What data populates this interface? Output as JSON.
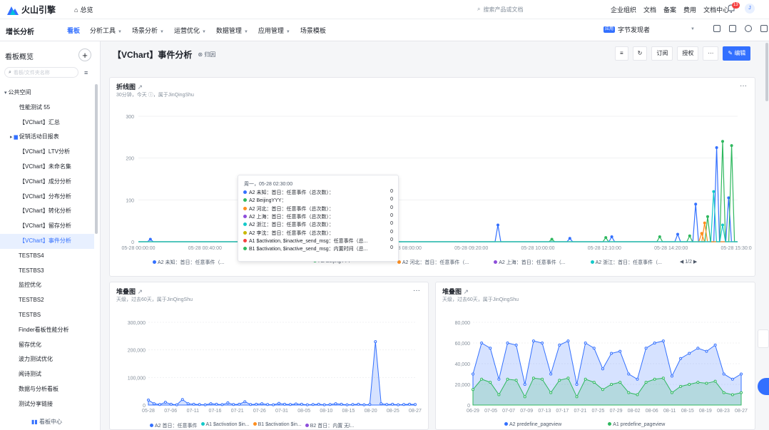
{
  "topbar": {
    "brand": "火山引擎",
    "home": "总览",
    "search_placeholder": "搜索产品或文档",
    "links": [
      "企业组织",
      "文档",
      "备案",
      "费用",
      "文档中心"
    ],
    "notif_count": "13",
    "avatar": "J"
  },
  "nav": {
    "section": "增长分析",
    "menu": [
      {
        "label": "看板",
        "active": true
      },
      {
        "label": "分析工具",
        "caret": true
      },
      {
        "label": "场景分析",
        "caret": true
      },
      {
        "label": "运营优化",
        "caret": true
      },
      {
        "label": "数据管理",
        "caret": true
      },
      {
        "label": "应用管理",
        "caret": true
      },
      {
        "label": "场景模板"
      }
    ],
    "workspace_tag": "应用",
    "workspace": "字节发现者"
  },
  "sidebar": {
    "title": "看板概览",
    "search_placeholder": "看板/文件夹名称",
    "items": [
      {
        "label": "公共空间",
        "type": "group",
        "arrow": "▾"
      },
      {
        "label": "性能测试 55",
        "type": "l1"
      },
      {
        "label": "【VChart】汇总",
        "type": "l1"
      },
      {
        "label": "促销活动日报表",
        "type": "folder",
        "arrow": "▸"
      },
      {
        "label": "【VChart】LTV分析",
        "type": "l1"
      },
      {
        "label": "【VChart】未命名集",
        "type": "l1"
      },
      {
        "label": "【VChart】成分分析",
        "type": "l1"
      },
      {
        "label": "【VChart】分布分析",
        "type": "l1"
      },
      {
        "label": "【VChart】转化分析",
        "type": "l1"
      },
      {
        "label": "【VChart】留存分析",
        "type": "l1"
      },
      {
        "label": "【VChart】事件分析",
        "type": "l1",
        "selected": true
      },
      {
        "label": "TESTBS4",
        "type": "l0"
      },
      {
        "label": "TESTBS3",
        "type": "l0"
      },
      {
        "label": "监控优化",
        "type": "l0"
      },
      {
        "label": "TESTBS2",
        "type": "l0"
      },
      {
        "label": "TESTBS",
        "type": "l0"
      },
      {
        "label": "Finder看板性能分析",
        "type": "l0"
      },
      {
        "label": "留存优化",
        "type": "l0"
      },
      {
        "label": "波力测试优化",
        "type": "l0"
      },
      {
        "label": "闻诗测试",
        "type": "l0"
      },
      {
        "label": "数据与分析看板",
        "type": "l0"
      },
      {
        "label": "测试分享链接",
        "type": "l0"
      }
    ],
    "footer": "看板中心"
  },
  "main": {
    "title": "【VChart】事件分析",
    "scope": "归因",
    "actions": [
      "订阅",
      "授权",
      "···",
      "编辑"
    ]
  },
  "line_card": {
    "title": "折线图",
    "subtitle": "30分钟，今天 ⓘ，属于JinQingShu",
    "more": "···",
    "x_ticks": [
      "05-28 00:00:00",
      "05-28 00:40:00",
      "05-28 04:00:00",
      "05-28 05:50:00",
      "05-28 08:00:00",
      "05-28 09:20:00",
      "05-28 10:00:00",
      "05-28 12:10:00",
      "05-28 14:20:00",
      "05-28 15:30:00"
    ],
    "y_ticks": [
      "0",
      "100",
      "200",
      "300"
    ],
    "legend": [
      "A2 未知：首日：任意事件（...",
      "A2 BeijingYYY",
      "A2 河北：首日：任意事件（...",
      "A2 上海：首日：任意事件（...",
      "A2 浙江：首日：任意事件（..."
    ],
    "pager": "1/2"
  },
  "chart_data": [
    {
      "type": "line",
      "title": "折线图",
      "ylim": [
        0,
        300
      ],
      "series": [
        {
          "name": "A2 未知：首日：任意事件",
          "color": "#3370ff",
          "values": [
            0,
            0,
            0,
            0,
            0,
            0,
            0,
            0,
            0,
            0,
            0,
            0,
            0,
            0,
            0,
            0,
            0,
            0,
            0,
            0,
            0,
            0,
            0,
            0,
            0,
            0,
            0,
            0,
            0,
            0,
            0,
            0,
            0,
            0,
            0,
            0,
            0,
            0,
            0,
            0,
            0,
            0,
            0,
            0,
            0,
            0,
            0,
            0,
            0,
            0,
            0,
            0,
            0,
            0,
            0,
            0,
            0,
            0,
            0,
            0,
            0,
            0,
            0,
            0,
            0,
            0,
            0,
            0,
            0,
            0,
            0,
            0,
            0,
            0,
            0,
            0,
            0,
            0,
            0,
            0,
            0,
            0,
            0,
            0,
            0,
            0,
            0,
            0,
            0,
            0,
            0,
            0,
            0,
            0,
            0,
            0,
            0,
            0,
            0,
            0,
            0,
            0,
            0,
            0,
            0,
            0,
            0,
            0,
            0,
            0,
            0,
            0,
            0,
            0,
            0,
            0,
            0,
            0,
            0,
            0,
            0,
            0,
            0,
            0,
            0,
            0,
            0,
            0,
            0,
            0,
            0,
            0,
            0,
            0,
            0,
            0,
            0,
            0,
            0,
            0,
            0,
            0,
            0,
            0,
            0,
            0,
            0,
            0,
            0,
            0,
            0,
            0,
            0,
            0,
            0,
            0,
            0,
            0,
            0,
            0,
            0,
            0,
            0,
            0,
            0,
            0,
            0,
            0,
            0,
            0,
            0,
            0,
            0,
            0,
            0,
            0,
            0,
            0,
            0,
            0,
            0,
            0,
            0,
            0,
            0,
            0,
            0,
            0,
            0,
            0,
            0,
            0,
            0,
            0,
            0,
            0,
            0,
            0,
            0,
            0,
            0,
            0,
            0,
            0,
            0,
            0,
            0,
            0,
            0,
            0,
            0,
            0,
            0,
            0,
            0,
            0,
            0,
            0,
            0,
            0,
            0,
            0,
            0,
            0,
            0,
            0,
            0,
            0,
            0,
            0,
            0,
            0,
            0,
            0,
            0,
            0,
            0,
            0,
            0,
            0,
            0,
            0,
            0,
            0,
            0,
            0,
            0,
            0,
            0,
            0,
            0,
            0,
            0,
            0,
            0,
            0,
            0,
            0,
            0,
            0,
            0,
            0,
            0,
            0,
            0,
            0,
            0,
            0,
            0,
            0,
            0,
            0,
            0,
            0,
            0,
            0,
            0,
            0,
            0,
            0,
            0,
            0,
            0,
            0,
            0,
            0,
            0,
            0,
            0,
            0,
            0,
            0,
            0,
            0,
            0,
            0,
            0,
            0,
            0,
            0,
            0,
            0,
            0,
            0,
            0,
            0,
            0,
            0,
            0,
            0,
            0,
            0,
            0,
            0,
            0,
            0,
            0,
            0,
            0,
            0,
            0,
            0,
            0,
            0,
            0,
            0,
            0,
            0,
            0,
            0,
            0,
            0,
            0,
            0,
            0,
            0,
            0,
            0,
            0,
            0,
            0,
            0,
            0,
            0,
            0
          ]
        },
        {
          "name": "A2 BeijingYYY",
          "color": "#2fb85f",
          "values": []
        },
        {
          "name": "A2 河北：首日：任意事件",
          "color": "#ff8f1f",
          "values": []
        },
        {
          "name": "A2 上海：首日：任意事件",
          "color": "#8d4eda",
          "values": []
        },
        {
          "name": "A2 浙江：首日：任意事件",
          "color": "#14c9c9",
          "values": []
        }
      ]
    },
    {
      "type": "area",
      "title": "堆叠图",
      "ylim": [
        0,
        300000
      ],
      "y_ticks": [
        "0",
        "100,000",
        "200,000",
        "300,000"
      ],
      "x_ticks": [
        "05-28",
        "07-06",
        "07-11",
        "07-16",
        "07-21",
        "07-26",
        "07-31",
        "08-05",
        "08-10",
        "08-15",
        "08-20",
        "08-25",
        "08-27"
      ],
      "series": [
        {
          "name": "A2 首日：任意事件",
          "color": "#3370ff",
          "values": [
            18000,
            5000,
            2000,
            10000,
            3000,
            1000,
            20000,
            5000,
            3000,
            2000,
            1000,
            5000,
            3000,
            1500,
            8000,
            2000,
            3000,
            12000,
            2000,
            3000,
            5000,
            2000,
            1000,
            6000,
            3000,
            2000,
            4000,
            3000,
            1000,
            2000,
            3000,
            1000,
            2000,
            5000,
            3000,
            1000,
            2000,
            3000,
            1000,
            2000,
            230000,
            5000,
            2000,
            3000,
            1000,
            2000,
            3000,
            2000
          ]
        }
      ]
    },
    {
      "type": "area",
      "title": "堆叠图",
      "ylim": [
        0,
        80000
      ],
      "y_ticks": [
        "0",
        "20,000",
        "40,000",
        "60,000",
        "80,000"
      ],
      "x_ticks": [
        "06-29",
        "07-05",
        "07-07",
        "07-09",
        "07-13",
        "07-17",
        "07-21",
        "07-25",
        "07-29",
        "08-02",
        "08-06",
        "08-11",
        "08-15",
        "08-19",
        "08-23",
        "08-27"
      ],
      "series": [
        {
          "name": "A2 predefine_pageview",
          "color": "#3370ff",
          "values": [
            30000,
            60000,
            55000,
            25000,
            60000,
            58000,
            20000,
            62000,
            60000,
            30000,
            58000,
            62000,
            20000,
            60000,
            55000,
            35000,
            50000,
            52000,
            30000,
            25000,
            55000,
            60000,
            62000,
            28000,
            45000,
            50000,
            55000,
            52000,
            58000,
            30000,
            25000,
            30000
          ]
        },
        {
          "name": "A1 predefine_pageview",
          "color": "#2fb85f",
          "values": [
            15000,
            25000,
            22000,
            10000,
            25000,
            24000,
            8000,
            26000,
            25000,
            12000,
            24000,
            26000,
            8000,
            25000,
            22000,
            15000,
            20000,
            22000,
            12000,
            10000,
            22000,
            25000,
            26000,
            12000,
            18000,
            20000,
            22000,
            21000,
            23000,
            12000,
            10000,
            12000
          ]
        }
      ]
    }
  ],
  "tooltip": {
    "title": "周一，05-28 02:30:00",
    "rows": [
      {
        "label": "A2 未知：首日：任意事件（总次数）：",
        "value": "0",
        "color": "#3370ff"
      },
      {
        "label": "A2 BeijingYYY：",
        "value": "0",
        "color": "#2fb85f"
      },
      {
        "label": "A2 河北：首日：任意事件（总次数）：",
        "value": "0",
        "color": "#ff8f1f"
      },
      {
        "label": "A2 上海：首日：任意事件（总次数）：",
        "value": "0",
        "color": "#8d4eda"
      },
      {
        "label": "A2 浙江：首日：任意事件（总次数）：",
        "value": "0",
        "color": "#14c9c9"
      },
      {
        "label": "A2 李沈：首日：任意事件（总次数）：",
        "value": "0",
        "color": "#c9b800"
      },
      {
        "label": "A1 $activation, $inactive_send_msg：任意事件（总...",
        "value": "0",
        "color": "#f53f3f"
      },
      {
        "label": "B1 $activation, $inactive_send_msg：内置时间（总...",
        "value": "0",
        "color": "#2fb85f"
      }
    ]
  },
  "stack1": {
    "title": "堆叠图",
    "subtitle": "天级，过去60天，属于JinQingShu",
    "more": "···",
    "legend": [
      "A2 首日：任意事件",
      "A1 $activation $in...",
      "B1 $activation $in...",
      "B2 首日：内置 无l..."
    ]
  },
  "stack2": {
    "title": "堆叠图",
    "subtitle": "天级，过去60天，属于JinQingShu",
    "legend": [
      "A2 predefine_pageview",
      "A1 predefine_pageview"
    ]
  }
}
